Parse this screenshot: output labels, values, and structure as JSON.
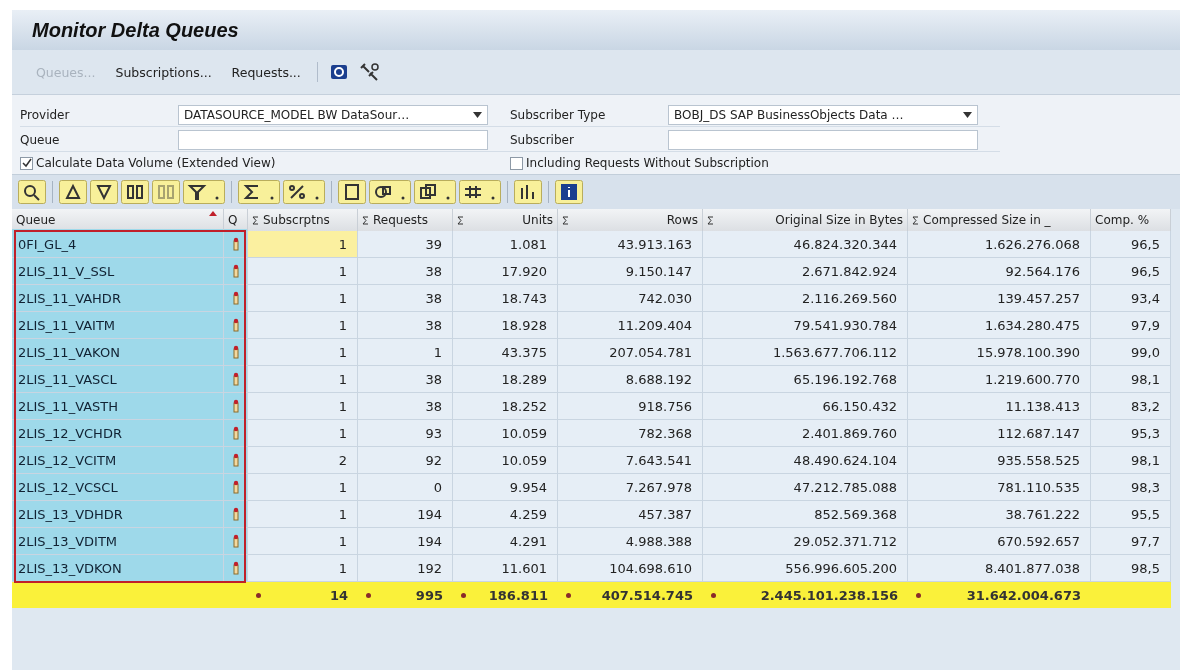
{
  "window": {
    "title": "Monitor Delta Queues"
  },
  "toolbar": [
    {
      "label": "Queues...",
      "disabled": true
    },
    {
      "label": "Subscriptions...",
      "disabled": false
    },
    {
      "label": "Requests...",
      "disabled": false
    }
  ],
  "form": {
    "left": [
      {
        "label": "Provider",
        "kind": "dropdown",
        "value": "DATASOURCE_MODEL BW DataSour…"
      },
      {
        "label": "Queue",
        "kind": "input"
      }
    ],
    "right": [
      {
        "label": "Subscriber Type",
        "kind": "dropdown",
        "value": "BOBJ_DS SAP BusinessObjects Data …"
      },
      {
        "label": "Subscriber",
        "kind": "input"
      }
    ],
    "checkboxes": [
      {
        "label": "Calculate Data Volume (Extended View)",
        "checked": true
      },
      {
        "label": "Including Requests Without Subscription",
        "checked": false
      }
    ]
  },
  "table": {
    "columns": [
      {
        "label": "Queue",
        "sum": false,
        "selected": true,
        "sorted": true
      },
      {
        "label": "Q",
        "sum": false,
        "selected": true,
        "sorted": false
      },
      {
        "label": "Subscrptns",
        "sum": true,
        "selected": false,
        "sorted": false
      },
      {
        "label": "Requests",
        "sum": true,
        "selected": false,
        "sorted": false
      },
      {
        "label": "Units",
        "sum": true,
        "selected": false,
        "sorted": false
      },
      {
        "label": "Rows",
        "sum": true,
        "selected": false,
        "sorted": false
      },
      {
        "label": "Original Size in Bytes",
        "sum": true,
        "selected": false,
        "sorted": false
      },
      {
        "label": "Compressed Size in _",
        "sum": true,
        "selected": false,
        "sorted": false
      },
      {
        "label": "Comp. %",
        "sum": false,
        "selected": false,
        "sorted": false
      }
    ],
    "rows": [
      {
        "focused": true,
        "cells": [
          "0FI_GL_4",
          "",
          "1",
          "39",
          "1.081",
          "43.913.163",
          "46.824.320.344",
          "1.626.276.068",
          "96,5"
        ]
      },
      {
        "focused": false,
        "cells": [
          "2LIS_11_V_SSL",
          "",
          "1",
          "38",
          "17.920",
          "9.150.147",
          "2.671.842.924",
          "92.564.176",
          "96,5"
        ]
      },
      {
        "focused": false,
        "cells": [
          "2LIS_11_VAHDR",
          "",
          "1",
          "38",
          "18.743",
          "742.030",
          "2.116.269.560",
          "139.457.257",
          "93,4"
        ]
      },
      {
        "focused": false,
        "cells": [
          "2LIS_11_VAITM",
          "",
          "1",
          "38",
          "18.928",
          "11.209.404",
          "79.541.930.784",
          "1.634.280.475",
          "97,9"
        ]
      },
      {
        "focused": false,
        "cells": [
          "2LIS_11_VAKON",
          "",
          "1",
          "1",
          "43.375",
          "207.054.781",
          "1.563.677.706.112",
          "15.978.100.390",
          "99,0"
        ]
      },
      {
        "focused": false,
        "cells": [
          "2LIS_11_VASCL",
          "",
          "1",
          "38",
          "18.289",
          "8.688.192",
          "65.196.192.768",
          "1.219.600.770",
          "98,1"
        ]
      },
      {
        "focused": false,
        "cells": [
          "2LIS_11_VASTH",
          "",
          "1",
          "38",
          "18.252",
          "918.756",
          "66.150.432",
          "11.138.413",
          "83,2"
        ]
      },
      {
        "focused": false,
        "cells": [
          "2LIS_12_VCHDR",
          "",
          "1",
          "93",
          "10.059",
          "782.368",
          "2.401.869.760",
          "112.687.147",
          "95,3"
        ]
      },
      {
        "focused": false,
        "cells": [
          "2LIS_12_VCITM",
          "",
          "2",
          "92",
          "10.059",
          "7.643.541",
          "48.490.624.104",
          "935.558.525",
          "98,1"
        ]
      },
      {
        "focused": false,
        "cells": [
          "2LIS_12_VCSCL",
          "",
          "1",
          "0",
          "9.954",
          "7.267.978",
          "47.212.785.088",
          "781.110.535",
          "98,3"
        ]
      },
      {
        "focused": false,
        "cells": [
          "2LIS_13_VDHDR",
          "",
          "1",
          "194",
          "4.259",
          "457.387",
          "852.569.368",
          "38.761.222",
          "95,5"
        ]
      },
      {
        "focused": false,
        "cells": [
          "2LIS_13_VDITM",
          "",
          "1",
          "194",
          "4.291",
          "4.988.388",
          "29.052.371.712",
          "670.592.657",
          "97,7"
        ]
      },
      {
        "focused": false,
        "cells": [
          "2LIS_13_VDKON",
          "",
          "1",
          "192",
          "11.601",
          "104.698.610",
          "556.996.605.200",
          "8.401.877.038",
          "98,5"
        ]
      }
    ],
    "totals": [
      "14",
      "995",
      "186.811",
      "407.514.745",
      "2.445.101.238.156",
      "31.642.004.673"
    ]
  }
}
